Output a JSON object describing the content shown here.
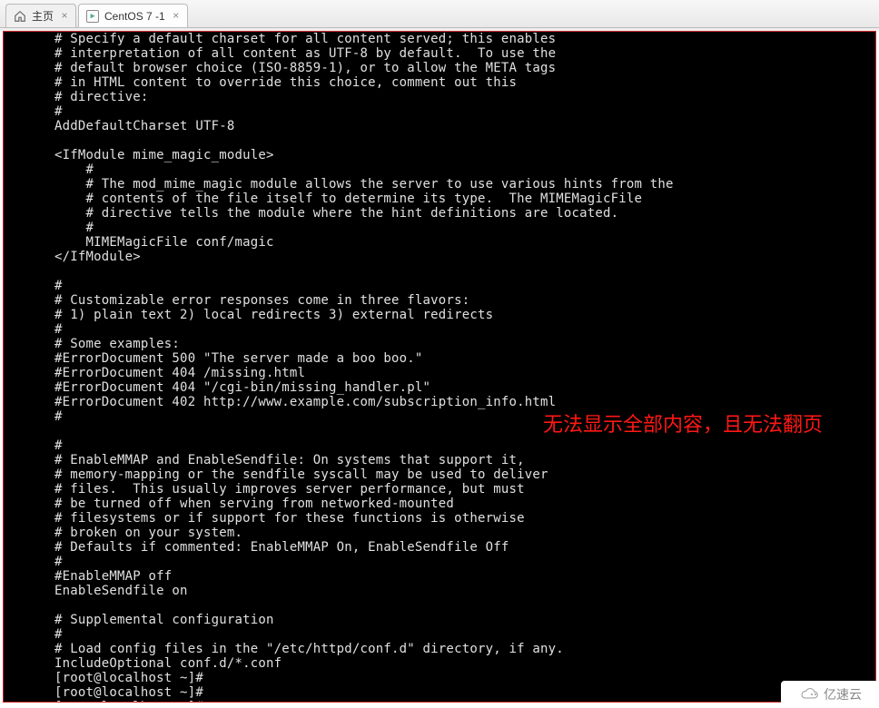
{
  "tabs": {
    "home_label": "主页",
    "vm_label": "CentOS 7 -1"
  },
  "terminal_lines": [
    "# Specify a default charset for all content served; this enables",
    "# interpretation of all content as UTF-8 by default.  To use the",
    "# default browser choice (ISO-8859-1), or to allow the META tags",
    "# in HTML content to override this choice, comment out this",
    "# directive:",
    "#",
    "AddDefaultCharset UTF-8",
    "",
    "<IfModule mime_magic_module>",
    "    #",
    "    # The mod_mime_magic module allows the server to use various hints from the",
    "    # contents of the file itself to determine its type.  The MIMEMagicFile",
    "    # directive tells the module where the hint definitions are located.",
    "    #",
    "    MIMEMagicFile conf/magic",
    "</IfModule>",
    "",
    "#",
    "# Customizable error responses come in three flavors:",
    "# 1) plain text 2) local redirects 3) external redirects",
    "#",
    "# Some examples:",
    "#ErrorDocument 500 \"The server made a boo boo.\"",
    "#ErrorDocument 404 /missing.html",
    "#ErrorDocument 404 \"/cgi-bin/missing_handler.pl\"",
    "#ErrorDocument 402 http://www.example.com/subscription_info.html",
    "#",
    "",
    "#",
    "# EnableMMAP and EnableSendfile: On systems that support it,",
    "# memory-mapping or the sendfile syscall may be used to deliver",
    "# files.  This usually improves server performance, but must",
    "# be turned off when serving from networked-mounted",
    "# filesystems or if support for these functions is otherwise",
    "# broken on your system.",
    "# Defaults if commented: EnableMMAP On, EnableSendfile Off",
    "#",
    "#EnableMMAP off",
    "EnableSendfile on",
    "",
    "# Supplemental configuration",
    "#",
    "# Load config files in the \"/etc/httpd/conf.d\" directory, if any.",
    "IncludeOptional conf.d/*.conf",
    "[root@localhost ~]#",
    "[root@localhost ~]#",
    "[root@localhost ~]# "
  ],
  "annotation_text": "无法显示全部内容，且无法翻页",
  "watermark_text": "亿速云"
}
